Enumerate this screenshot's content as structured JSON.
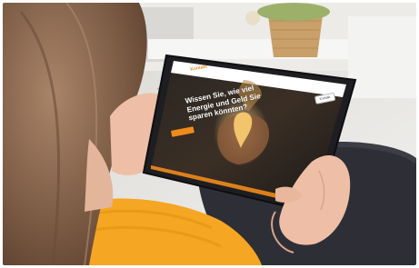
{
  "scene": {
    "description_colors": {
      "background": "#e8e8e4",
      "sweater": "#f5a623",
      "hair": "#8a6a52",
      "tablet_body": "#1e1e22",
      "accent_orange": "#f08a1c"
    }
  },
  "tablet_screen": {
    "logo_text": "Kontakt",
    "header_button": "Kontakt",
    "headline_line1": "Wissen Sie, wie viel",
    "headline_line2": "Energie und Geld Sie",
    "headline_line3": "sparen könnten?",
    "cta_label": ""
  }
}
